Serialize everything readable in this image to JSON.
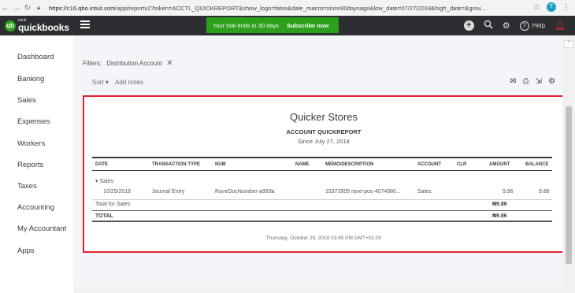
{
  "browser": {
    "url_host": "https://c16.qbo.intuit.com",
    "url_path": "/app/reportv2?token=ACCTL_QUICKREPORT&show_logo=false&date_macro=since90daysago&low_date=07/27/2018&high_date=&grou...",
    "profile": "T"
  },
  "brand": {
    "intuit": "intuit",
    "name": "quickbooks"
  },
  "trial": {
    "text": "Your trial ends in 30 days",
    "cta": "Subscribe now"
  },
  "topnav": {
    "help": "Help"
  },
  "sidebar": {
    "items": [
      "Dashboard",
      "Banking",
      "Sales",
      "Expenses",
      "Workers",
      "Reports",
      "Taxes",
      "Accounting",
      "My Accountant",
      "Apps"
    ]
  },
  "filters": {
    "label": "Filters:",
    "chip": "Distribution Account"
  },
  "toolbar": {
    "sort": "Sort ▾",
    "notes": "Add notes"
  },
  "report": {
    "company": "Quicker Stores",
    "title": "ACCOUNT QUICKREPORT",
    "date_range": "Since July 27, 2018",
    "columns": [
      "DATE",
      "TRANSACTION TYPE",
      "NUM",
      "NAME",
      "MEMO/DESCRIPTION",
      "ACCOUNT",
      "CLR",
      "AMOUNT",
      "BALANCE"
    ],
    "group": "▾ Sales",
    "row": {
      "date": "10/25/2018",
      "type": "Journal Entry",
      "num": "RaveDocNumber-a993a",
      "memo": "15373505 rave-pos-4074080...",
      "account": "Sales",
      "amount": "9.86",
      "balance": "9.86"
    },
    "total_sales_label": "Total for Sales",
    "total_sales_amount": "₦9.86",
    "total_label": "TOTAL",
    "total_amount": "₦9.86",
    "footer": "Thursday, October 25, 2018  03:45 PM GMT+01:00"
  }
}
